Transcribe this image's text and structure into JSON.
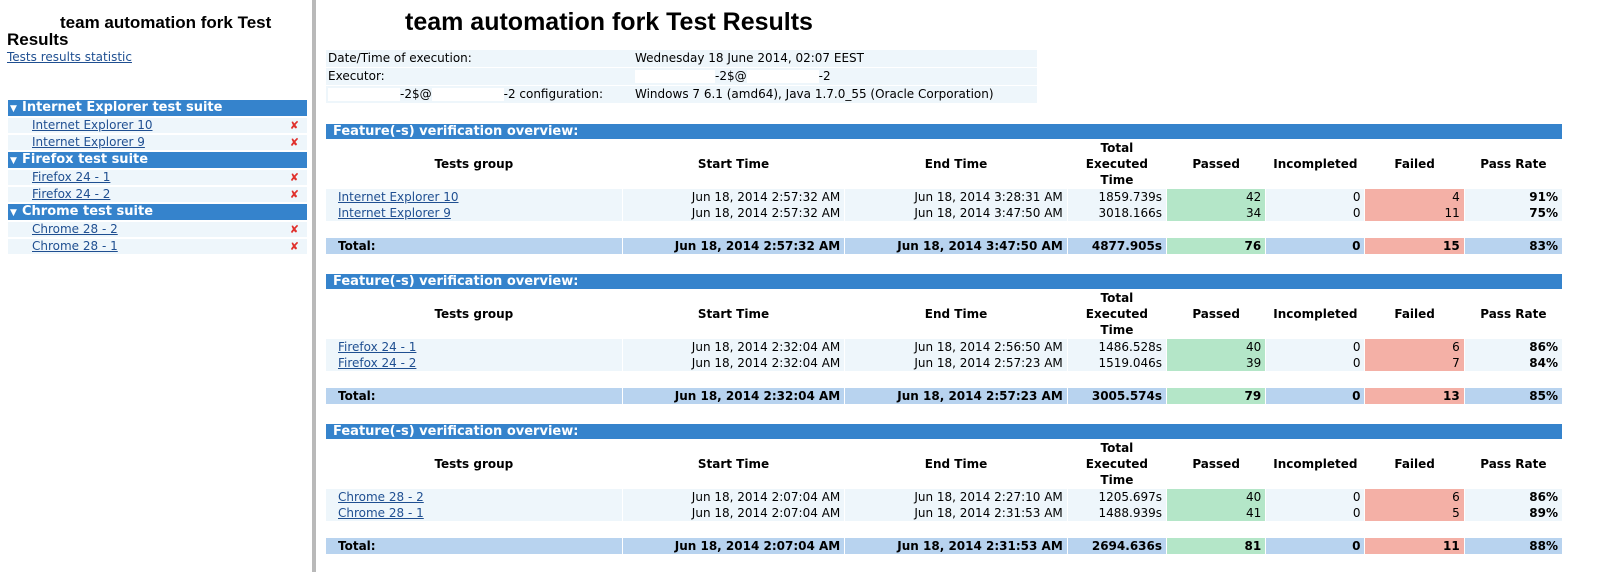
{
  "sidebar": {
    "title": "team automation fork Test Results",
    "stats_link": "Tests results statistic",
    "suites": [
      {
        "name": "Internet Explorer test suite",
        "items": [
          {
            "label": "Internet Explorer 10",
            "status": "✘"
          },
          {
            "label": "Internet Explorer 9",
            "status": "✘"
          }
        ]
      },
      {
        "name": "Firefox test suite",
        "items": [
          {
            "label": "Firefox 24 - 1",
            "status": "✘"
          },
          {
            "label": "Firefox 24 - 2",
            "status": "✘"
          }
        ]
      },
      {
        "name": "Chrome test suite",
        "items": [
          {
            "label": "Chrome 28 - 2",
            "status": "✘"
          },
          {
            "label": "Chrome 28 - 1",
            "status": "✘"
          }
        ]
      }
    ]
  },
  "main": {
    "title": "team automation fork Test Results",
    "exec_info": {
      "datetime_label": "Date/Time of execution:",
      "datetime_value": "Wednesday 18 June 2014, 02:07 EEST",
      "executor_label": "Executor:",
      "executor_value_a": "-2$@",
      "executor_value_b": "-2",
      "config_label_a": "-2$@",
      "config_label_b": "-2 configuration:",
      "config_value": "Windows 7 6.1 (amd64), Java 1.7.0_55 (Oracle Corporation)"
    },
    "overview_title": "Feature(-s) verification overview:",
    "columns": {
      "group": "Tests group",
      "start": "Start Time",
      "end": "End Time",
      "total_line1": "Total",
      "total_line2": "Executed",
      "total_line3": "Time",
      "passed": "Passed",
      "incompleted": "Incompleted",
      "failed": "Failed",
      "pass_rate": "Pass Rate"
    },
    "total_label": "Total:",
    "overviews": [
      {
        "rows": [
          {
            "group": "Internet Explorer 10",
            "start": "Jun 18, 2014 2:57:32 AM",
            "end": "Jun 18, 2014 3:28:31 AM",
            "time": "1859.739s",
            "passed": "42",
            "incompleted": "0",
            "failed": "4",
            "rate": "91%"
          },
          {
            "group": "Internet Explorer 9",
            "start": "Jun 18, 2014 2:57:32 AM",
            "end": "Jun 18, 2014 3:47:50 AM",
            "time": "3018.166s",
            "passed": "34",
            "incompleted": "0",
            "failed": "11",
            "rate": "75%"
          }
        ],
        "total": {
          "start": "Jun 18, 2014 2:57:32 AM",
          "end": "Jun 18, 2014 3:47:50 AM",
          "time": "4877.905s",
          "passed": "76",
          "incompleted": "0",
          "failed": "15",
          "rate": "83%"
        }
      },
      {
        "rows": [
          {
            "group": "Firefox 24 - 1",
            "start": "Jun 18, 2014 2:32:04 AM",
            "end": "Jun 18, 2014 2:56:50 AM",
            "time": "1486.528s",
            "passed": "40",
            "incompleted": "0",
            "failed": "6",
            "rate": "86%"
          },
          {
            "group": "Firefox 24 - 2",
            "start": "Jun 18, 2014 2:32:04 AM",
            "end": "Jun 18, 2014 2:57:23 AM",
            "time": "1519.046s",
            "passed": "39",
            "incompleted": "0",
            "failed": "7",
            "rate": "84%"
          }
        ],
        "total": {
          "start": "Jun 18, 2014 2:32:04 AM",
          "end": "Jun 18, 2014 2:57:23 AM",
          "time": "3005.574s",
          "passed": "79",
          "incompleted": "0",
          "failed": "13",
          "rate": "85%"
        }
      },
      {
        "rows": [
          {
            "group": "Chrome 28 - 2",
            "start": "Jun 18, 2014 2:07:04 AM",
            "end": "Jun 18, 2014 2:27:10 AM",
            "time": "1205.697s",
            "passed": "40",
            "incompleted": "0",
            "failed": "6",
            "rate": "86%"
          },
          {
            "group": "Chrome 28 - 1",
            "start": "Jun 18, 2014 2:07:04 AM",
            "end": "Jun 18, 2014 2:31:53 AM",
            "time": "1488.939s",
            "passed": "41",
            "incompleted": "0",
            "failed": "5",
            "rate": "89%"
          }
        ],
        "total": {
          "start": "Jun 18, 2014 2:07:04 AM",
          "end": "Jun 18, 2014 2:31:53 AM",
          "time": "2694.636s",
          "passed": "81",
          "incompleted": "0",
          "failed": "11",
          "rate": "88%"
        }
      }
    ]
  },
  "colors": {
    "header_blue": "#3583cc",
    "total_row": "#b8d3ef",
    "passed_green": "#b4e6c8",
    "failed_red": "#f4b0a6",
    "link": "#1f4f91",
    "fail_mark": "#e0302c"
  },
  "icons": {
    "suite_toggle": "triangle-down-icon",
    "fail_mark": "cross-mark-icon"
  }
}
